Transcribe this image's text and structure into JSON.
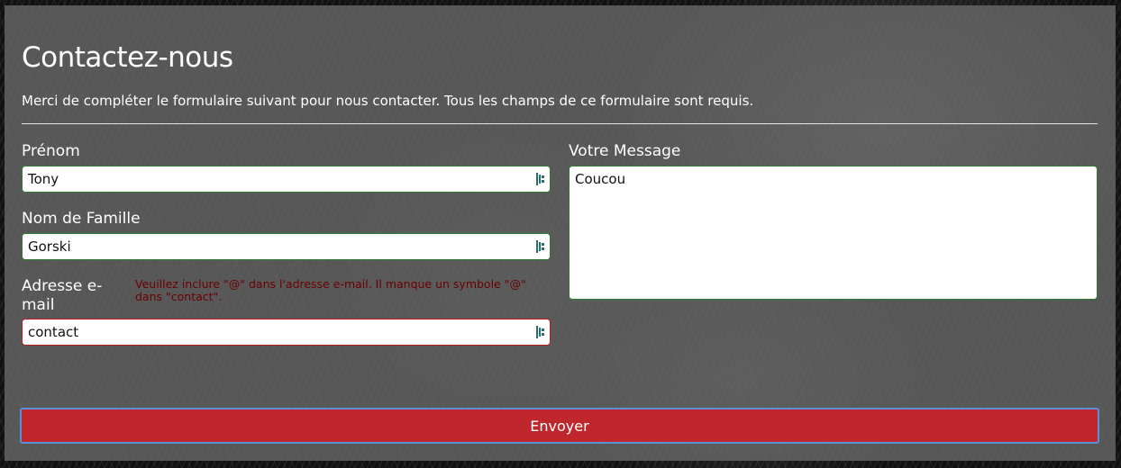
{
  "form": {
    "title": "Contactez-nous",
    "intro": "Merci de compléter le formulaire suivant pour nous contacter. Tous les champs de ce formulaire sont requis.",
    "first_name": {
      "label": "Prénom",
      "value": "Tony",
      "icon": "password-manager-key-icon"
    },
    "last_name": {
      "label": "Nom de Famille",
      "value": "Gorski",
      "icon": "password-manager-key-icon"
    },
    "email": {
      "label": "Adresse e-mail",
      "value": "contact",
      "icon": "password-manager-key-icon",
      "error": "Veuillez inclure \"@\" dans l'adresse e-mail. Il manque un symbole \"@\" dans \"contact\"."
    },
    "message": {
      "label": "Votre Message",
      "value": "Coucou"
    },
    "submit_label": "Envoyer"
  },
  "colors": {
    "panel": "#696969",
    "valid_border": "#2e7d32",
    "invalid_border": "#b71c1c",
    "error_text": "#6b0000",
    "button_bg": "#c0272d",
    "button_focus_ring": "#5b8fd8"
  }
}
